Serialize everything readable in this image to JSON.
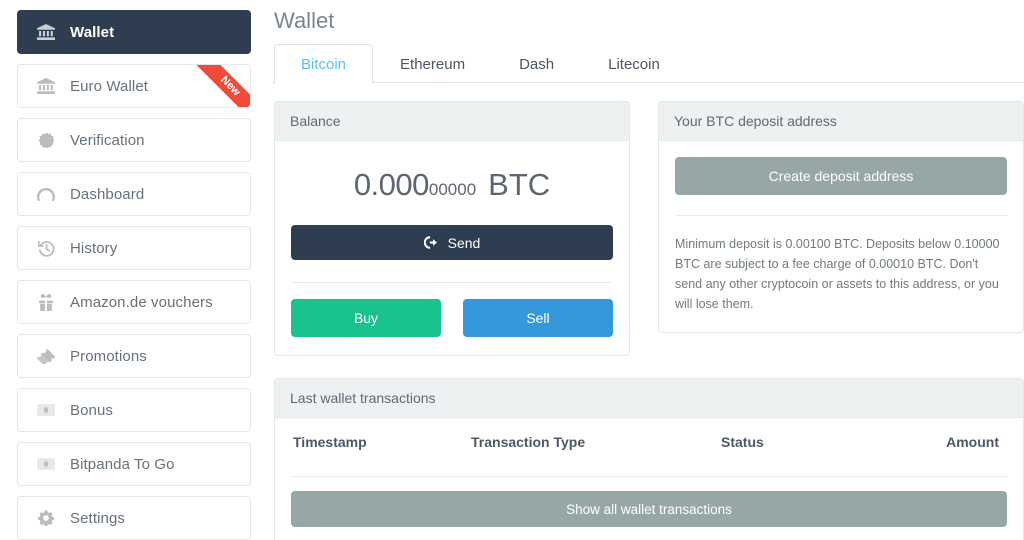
{
  "sidebar": {
    "items": [
      {
        "label": "Wallet",
        "icon": "bank-icon",
        "active": true,
        "badge": null
      },
      {
        "label": "Euro Wallet",
        "icon": "bank-icon",
        "active": false,
        "badge": "New"
      },
      {
        "label": "Verification",
        "icon": "badge-icon",
        "active": false,
        "badge": null
      },
      {
        "label": "Dashboard",
        "icon": "gauge-icon",
        "active": false,
        "badge": null
      },
      {
        "label": "History",
        "icon": "history-icon",
        "active": false,
        "badge": null
      },
      {
        "label": "Amazon.de vouchers",
        "icon": "gift-icon",
        "active": false,
        "badge": null
      },
      {
        "label": "Promotions",
        "icon": "ticket-icon",
        "active": false,
        "badge": null
      },
      {
        "label": "Bonus",
        "icon": "money-bill-icon",
        "active": false,
        "badge": null
      },
      {
        "label": "Bitpanda To Go",
        "icon": "money-bill-icon",
        "active": false,
        "badge": null
      },
      {
        "label": "Settings",
        "icon": "gear-icon",
        "active": false,
        "badge": null
      }
    ]
  },
  "main": {
    "page_title": "Wallet",
    "tabs": [
      {
        "label": "Bitcoin",
        "active": true
      },
      {
        "label": "Ethereum",
        "active": false
      },
      {
        "label": "Dash",
        "active": false
      },
      {
        "label": "Litecoin",
        "active": false
      }
    ],
    "balance_panel": {
      "header": "Balance",
      "amount_major": "0.000",
      "amount_minor": "00000",
      "currency": "BTC",
      "send_label": "Send",
      "send_icon": "sign-out-icon",
      "buy_label": "Buy",
      "sell_label": "Sell"
    },
    "deposit_panel": {
      "header": "Your BTC deposit address",
      "create_label": "Create deposit address",
      "note": "Minimum deposit is 0.00100 BTC. Deposits below 0.10000 BTC are subject to a fee charge of 0.00010 BTC. Don't send any other cryptocoin or assets to this address, or you will lose them."
    },
    "transactions_panel": {
      "header": "Last wallet transactions",
      "columns": [
        "Timestamp",
        "Transaction Type",
        "Status",
        "Amount"
      ],
      "rows": [],
      "show_all_label": "Show all wallet transactions"
    }
  },
  "colors": {
    "sidebar_active": "#2e3d4f",
    "tab_active_text": "#54c4f0",
    "ribbon": "#ef4a3a",
    "buy": "#19c18c",
    "sell": "#3498db",
    "muted_button": "#97a7a5",
    "panel_header_bg": "#eef1f2"
  }
}
